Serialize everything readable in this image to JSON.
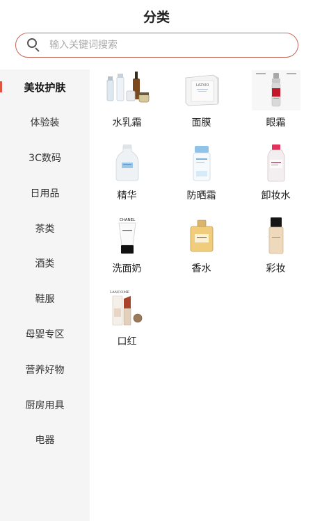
{
  "header": {
    "title": "分类"
  },
  "search": {
    "placeholder": "输入关键词搜索"
  },
  "sidebar": {
    "items": [
      {
        "label": "美妆护肤"
      },
      {
        "label": "体验装"
      },
      {
        "label": "3C数码"
      },
      {
        "label": "日用品"
      },
      {
        "label": "茶类"
      },
      {
        "label": "酒类"
      },
      {
        "label": "鞋服"
      },
      {
        "label": "母婴专区"
      },
      {
        "label": "营养好物"
      },
      {
        "label": "厨房用具"
      },
      {
        "label": "电器"
      }
    ]
  },
  "categories": [
    {
      "label": "水乳霜",
      "icon": "skincare-set-icon"
    },
    {
      "label": "面膜",
      "icon": "face-mask-box-icon"
    },
    {
      "label": "眼霜",
      "icon": "eye-cream-pump-icon"
    },
    {
      "label": "精华",
      "icon": "essence-bottle-icon"
    },
    {
      "label": "防晒霜",
      "icon": "sunscreen-bottle-icon"
    },
    {
      "label": "卸妆水",
      "icon": "makeup-remover-bottle-icon"
    },
    {
      "label": "洗面奶",
      "icon": "cleanser-tube-icon"
    },
    {
      "label": "香水",
      "icon": "perfume-bottle-icon"
    },
    {
      "label": "彩妆",
      "icon": "foundation-bottle-icon"
    },
    {
      "label": "口红",
      "icon": "lipstick-icon"
    }
  ],
  "product_images": {
    "mask_box_text": "LAZVIO",
    "cleanser_brand": "CHANEL",
    "lipstick_brand": "LANCOME"
  }
}
